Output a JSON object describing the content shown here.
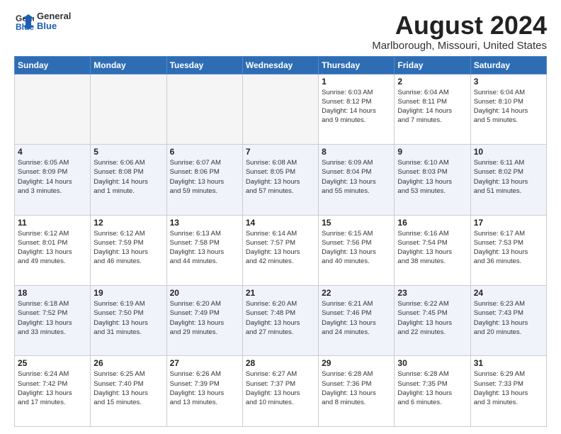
{
  "header": {
    "logo_line1": "General",
    "logo_line2": "Blue",
    "main_title": "August 2024",
    "subtitle": "Marlborough, Missouri, United States"
  },
  "weekdays": [
    "Sunday",
    "Monday",
    "Tuesday",
    "Wednesday",
    "Thursday",
    "Friday",
    "Saturday"
  ],
  "weeks": [
    [
      {
        "day": "",
        "info": "",
        "empty": true
      },
      {
        "day": "",
        "info": "",
        "empty": true
      },
      {
        "day": "",
        "info": "",
        "empty": true
      },
      {
        "day": "",
        "info": "",
        "empty": true
      },
      {
        "day": "1",
        "info": "Sunrise: 6:03 AM\nSunset: 8:12 PM\nDaylight: 14 hours\nand 9 minutes.",
        "empty": false
      },
      {
        "day": "2",
        "info": "Sunrise: 6:04 AM\nSunset: 8:11 PM\nDaylight: 14 hours\nand 7 minutes.",
        "empty": false
      },
      {
        "day": "3",
        "info": "Sunrise: 6:04 AM\nSunset: 8:10 PM\nDaylight: 14 hours\nand 5 minutes.",
        "empty": false
      }
    ],
    [
      {
        "day": "4",
        "info": "Sunrise: 6:05 AM\nSunset: 8:09 PM\nDaylight: 14 hours\nand 3 minutes.",
        "empty": false
      },
      {
        "day": "5",
        "info": "Sunrise: 6:06 AM\nSunset: 8:08 PM\nDaylight: 14 hours\nand 1 minute.",
        "empty": false
      },
      {
        "day": "6",
        "info": "Sunrise: 6:07 AM\nSunset: 8:06 PM\nDaylight: 13 hours\nand 59 minutes.",
        "empty": false
      },
      {
        "day": "7",
        "info": "Sunrise: 6:08 AM\nSunset: 8:05 PM\nDaylight: 13 hours\nand 57 minutes.",
        "empty": false
      },
      {
        "day": "8",
        "info": "Sunrise: 6:09 AM\nSunset: 8:04 PM\nDaylight: 13 hours\nand 55 minutes.",
        "empty": false
      },
      {
        "day": "9",
        "info": "Sunrise: 6:10 AM\nSunset: 8:03 PM\nDaylight: 13 hours\nand 53 minutes.",
        "empty": false
      },
      {
        "day": "10",
        "info": "Sunrise: 6:11 AM\nSunset: 8:02 PM\nDaylight: 13 hours\nand 51 minutes.",
        "empty": false
      }
    ],
    [
      {
        "day": "11",
        "info": "Sunrise: 6:12 AM\nSunset: 8:01 PM\nDaylight: 13 hours\nand 49 minutes.",
        "empty": false
      },
      {
        "day": "12",
        "info": "Sunrise: 6:12 AM\nSunset: 7:59 PM\nDaylight: 13 hours\nand 46 minutes.",
        "empty": false
      },
      {
        "day": "13",
        "info": "Sunrise: 6:13 AM\nSunset: 7:58 PM\nDaylight: 13 hours\nand 44 minutes.",
        "empty": false
      },
      {
        "day": "14",
        "info": "Sunrise: 6:14 AM\nSunset: 7:57 PM\nDaylight: 13 hours\nand 42 minutes.",
        "empty": false
      },
      {
        "day": "15",
        "info": "Sunrise: 6:15 AM\nSunset: 7:56 PM\nDaylight: 13 hours\nand 40 minutes.",
        "empty": false
      },
      {
        "day": "16",
        "info": "Sunrise: 6:16 AM\nSunset: 7:54 PM\nDaylight: 13 hours\nand 38 minutes.",
        "empty": false
      },
      {
        "day": "17",
        "info": "Sunrise: 6:17 AM\nSunset: 7:53 PM\nDaylight: 13 hours\nand 36 minutes.",
        "empty": false
      }
    ],
    [
      {
        "day": "18",
        "info": "Sunrise: 6:18 AM\nSunset: 7:52 PM\nDaylight: 13 hours\nand 33 minutes.",
        "empty": false
      },
      {
        "day": "19",
        "info": "Sunrise: 6:19 AM\nSunset: 7:50 PM\nDaylight: 13 hours\nand 31 minutes.",
        "empty": false
      },
      {
        "day": "20",
        "info": "Sunrise: 6:20 AM\nSunset: 7:49 PM\nDaylight: 13 hours\nand 29 minutes.",
        "empty": false
      },
      {
        "day": "21",
        "info": "Sunrise: 6:20 AM\nSunset: 7:48 PM\nDaylight: 13 hours\nand 27 minutes.",
        "empty": false
      },
      {
        "day": "22",
        "info": "Sunrise: 6:21 AM\nSunset: 7:46 PM\nDaylight: 13 hours\nand 24 minutes.",
        "empty": false
      },
      {
        "day": "23",
        "info": "Sunrise: 6:22 AM\nSunset: 7:45 PM\nDaylight: 13 hours\nand 22 minutes.",
        "empty": false
      },
      {
        "day": "24",
        "info": "Sunrise: 6:23 AM\nSunset: 7:43 PM\nDaylight: 13 hours\nand 20 minutes.",
        "empty": false
      }
    ],
    [
      {
        "day": "25",
        "info": "Sunrise: 6:24 AM\nSunset: 7:42 PM\nDaylight: 13 hours\nand 17 minutes.",
        "empty": false
      },
      {
        "day": "26",
        "info": "Sunrise: 6:25 AM\nSunset: 7:40 PM\nDaylight: 13 hours\nand 15 minutes.",
        "empty": false
      },
      {
        "day": "27",
        "info": "Sunrise: 6:26 AM\nSunset: 7:39 PM\nDaylight: 13 hours\nand 13 minutes.",
        "empty": false
      },
      {
        "day": "28",
        "info": "Sunrise: 6:27 AM\nSunset: 7:37 PM\nDaylight: 13 hours\nand 10 minutes.",
        "empty": false
      },
      {
        "day": "29",
        "info": "Sunrise: 6:28 AM\nSunset: 7:36 PM\nDaylight: 13 hours\nand 8 minutes.",
        "empty": false
      },
      {
        "day": "30",
        "info": "Sunrise: 6:28 AM\nSunset: 7:35 PM\nDaylight: 13 hours\nand 6 minutes.",
        "empty": false
      },
      {
        "day": "31",
        "info": "Sunrise: 6:29 AM\nSunset: 7:33 PM\nDaylight: 13 hours\nand 3 minutes.",
        "empty": false
      }
    ]
  ]
}
